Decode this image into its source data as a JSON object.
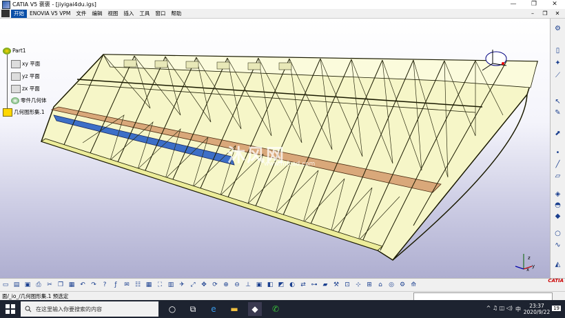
{
  "window": {
    "title": "CATIA V5 褒褒 - [jiyigai4du.igs]",
    "min": "—",
    "max": "❐",
    "close": "✕"
  },
  "menu": {
    "items": [
      "开始",
      "ENOVIA V5 VPM",
      "文件",
      "编辑",
      "视图",
      "插入",
      "工具",
      "窗口",
      "帮助"
    ],
    "active_index": 0
  },
  "mdi": {
    "min": "–",
    "max": "❐",
    "close": "✕"
  },
  "tree": {
    "root": "Part1",
    "items": [
      "xy 平面",
      "yz 平面",
      "zx 平面",
      "零件几何体",
      "几何图形集.1"
    ],
    "selected_index": 4
  },
  "watermark": {
    "text": "沐风网",
    "url": "www.mfcad.com"
  },
  "axes": {
    "x": "x",
    "y": "y",
    "z": "z"
  },
  "status": {
    "text": "面/_io_/几何图形集.1 预选定"
  },
  "branding": {
    "catia": "CATIA"
  },
  "taskbar": {
    "search_placeholder": "在这里输入你要搜索的内容",
    "time": "23:37",
    "date": "2020/9/22",
    "ime": "中",
    "notifications": "19"
  },
  "colors": {
    "accent": "#0a4fa8",
    "selection": "#f07818",
    "part": "#f6f6c8",
    "edge": "#1a1a00"
  }
}
